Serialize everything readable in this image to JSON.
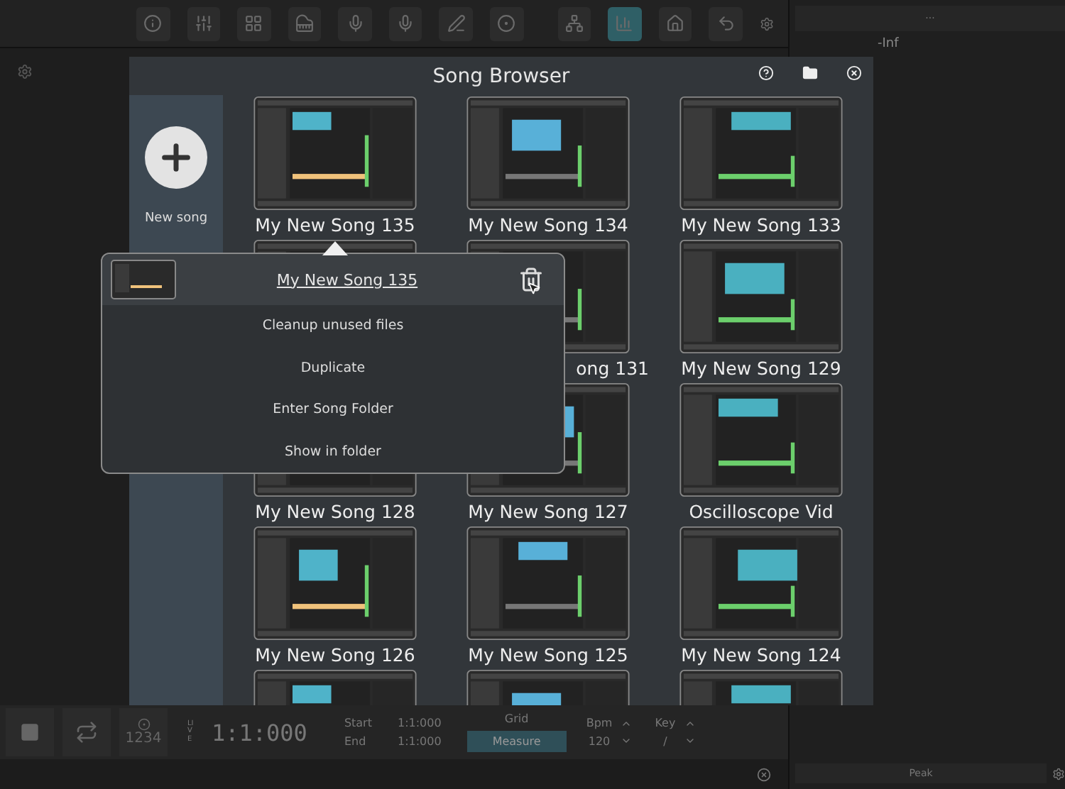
{
  "toolbar": {
    "tools": [
      {
        "kind": "info",
        "selected": false
      },
      {
        "kind": "mixer",
        "selected": false
      },
      {
        "kind": "grid",
        "selected": false
      },
      {
        "kind": "piano",
        "selected": false
      },
      {
        "kind": "mic",
        "selected": false
      },
      {
        "kind": "mic",
        "selected": false
      },
      {
        "kind": "pen",
        "selected": false
      },
      {
        "kind": "circle",
        "selected": false
      }
    ],
    "right_tools": [
      {
        "kind": "network",
        "selected": false
      },
      {
        "kind": "meter",
        "selected": true
      },
      {
        "kind": "home",
        "selected": false
      },
      {
        "kind": "undo",
        "selected": false
      }
    ]
  },
  "meter_panel": {
    "more": "···",
    "reading": "-Inf",
    "mode": "Peak"
  },
  "song_browser": {
    "title": "Song Browser",
    "new_song": "New song",
    "songs": [
      {
        "kind": "full",
        "label": "My New Song 135"
      },
      {
        "kind": "full",
        "label": "My New Song 134"
      },
      {
        "kind": "full",
        "label": "My New Song 133"
      },
      {
        "kind": "covered"
      },
      {
        "kind": "partial",
        "label": "ong 131"
      },
      {
        "kind": "full",
        "label": "My New Song 129"
      },
      {
        "kind": "full",
        "label": "My New Song 128"
      },
      {
        "kind": "full",
        "label": "My New Song 127"
      },
      {
        "kind": "full",
        "label": "Oscilloscope Vid"
      },
      {
        "kind": "full",
        "label": "My New Song 126"
      },
      {
        "kind": "full",
        "label": "My New Song 125"
      },
      {
        "kind": "full",
        "label": "My New Song 124"
      },
      {
        "kind": "cut"
      },
      {
        "kind": "cut"
      },
      {
        "kind": "cut"
      }
    ],
    "menu": {
      "title": "My New Song 135",
      "items": [
        "Cleanup unused files",
        "Duplicate",
        "Enter Song Folder",
        "Show in folder"
      ]
    }
  },
  "transport": {
    "count_in": "1234",
    "live": "LIVE",
    "position": "1:1:000",
    "start_label": "Start",
    "start": "1:1:000",
    "end_label": "End",
    "end": "1:1:000",
    "grid_label": "Grid",
    "grid": "Measure",
    "bpm_label": "Bpm",
    "bpm": "120",
    "key_label": "Key",
    "key": "/"
  }
}
